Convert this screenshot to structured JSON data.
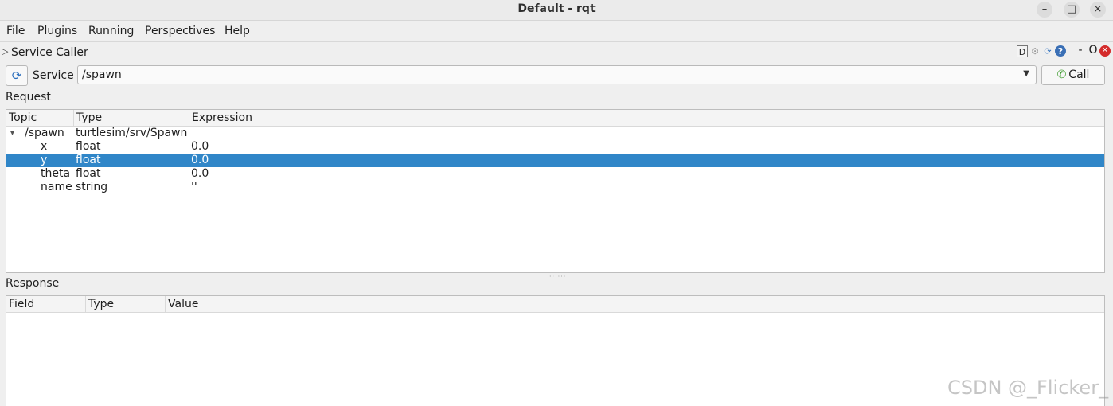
{
  "window": {
    "title": "Default - rqt",
    "minimize_icon": "–",
    "maximize_icon": "□",
    "close_icon": "×"
  },
  "menubar": {
    "items": [
      {
        "label": "File"
      },
      {
        "label": "Plugins"
      },
      {
        "label": "Running"
      },
      {
        "label": "Perspectives"
      },
      {
        "label": "Help"
      }
    ]
  },
  "plugin": {
    "title": "Service Caller",
    "collapse_glyph": "▷",
    "header_buttons": {
      "d": "D",
      "gear": "⚙",
      "reload": "⟳",
      "help": "?",
      "minimize": "-",
      "float": "O",
      "close": "✕"
    }
  },
  "service": {
    "refresh_glyph": "⟳",
    "label": "Service",
    "value": "/spawn",
    "dropdown_glyph": "▼",
    "call_label": "Call",
    "call_icon": "✆"
  },
  "request": {
    "label": "Request",
    "columns": [
      "Topic",
      "Type",
      "Expression"
    ],
    "rows": [
      {
        "expander": "▾",
        "topic": "/spawn",
        "type": "turtlesim/srv/Spawn",
        "expression": "",
        "selected": false
      },
      {
        "expander": "",
        "topic": "x",
        "type": "float",
        "expression": "0.0",
        "selected": false
      },
      {
        "expander": "",
        "topic": "y",
        "type": "float",
        "expression": "0.0",
        "selected": true
      },
      {
        "expander": "",
        "topic": "theta",
        "type": "float",
        "expression": "0.0",
        "selected": false
      },
      {
        "expander": "",
        "topic": "name",
        "type": "string",
        "expression": "''",
        "selected": false
      }
    ]
  },
  "response": {
    "label": "Response",
    "columns": [
      "Field",
      "Type",
      "Value"
    ]
  },
  "splitter_glyph": "······",
  "watermark": "CSDN @_Flicker_",
  "colors": {
    "selection": "#3086c8",
    "call_icon": "#3a9a2a",
    "close_red": "#d42b2b"
  }
}
